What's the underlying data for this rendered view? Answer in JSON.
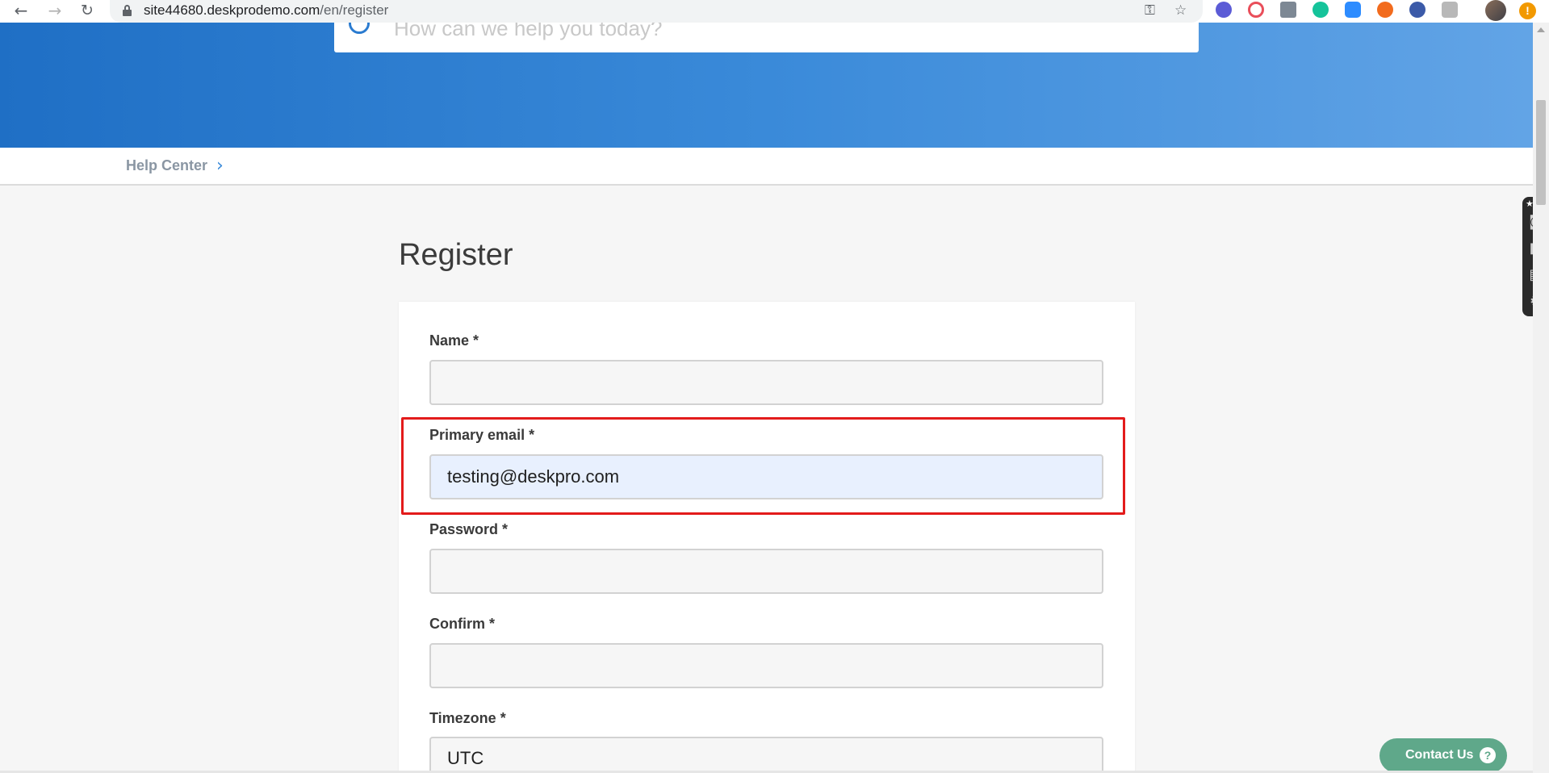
{
  "browser": {
    "url_host": "site44680.deskprodemo.com",
    "url_path": "/en/register"
  },
  "search": {
    "placeholder": "How can we help you today?"
  },
  "breadcrumb": {
    "home": "Help Center"
  },
  "page": {
    "title": "Register"
  },
  "form": {
    "fields": [
      {
        "label": "Name *",
        "value": ""
      },
      {
        "label": "Primary email *",
        "value": "testing@deskpro.com"
      },
      {
        "label": "Password *",
        "value": ""
      },
      {
        "label": "Confirm *",
        "value": ""
      },
      {
        "label": "Timezone *",
        "value": "UTC"
      }
    ]
  },
  "contact": {
    "label": "Contact Us",
    "help_glyph": "?"
  },
  "colors": {
    "brand_blue": "#1f6fc5",
    "highlight_red": "#e31b1b",
    "contact_green": "#5fa88a",
    "autofill_bg": "#e8f0fe"
  },
  "icons": [
    "back-arrow-icon",
    "forward-arrow-icon",
    "reload-icon",
    "lock-icon",
    "key-icon",
    "star-icon",
    "search-icon",
    "chevron-right-icon",
    "camera-icon",
    "video-icon",
    "gallery-icon",
    "gear-icon",
    "help-icon"
  ]
}
